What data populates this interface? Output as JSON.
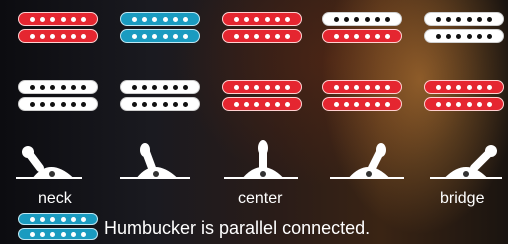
{
  "positions": [
    {
      "label": "neck",
      "row1": [
        "red",
        "red"
      ],
      "row2": [
        "white",
        "white"
      ]
    },
    {
      "label": "",
      "row1": [
        "blue",
        "blue"
      ],
      "row2": [
        "white",
        "white"
      ]
    },
    {
      "label": "center",
      "row1": [
        "red",
        "red"
      ],
      "row2": [
        "red",
        "red"
      ]
    },
    {
      "label": "",
      "row1": [
        "white",
        "red"
      ],
      "row2": [
        "red",
        "red"
      ]
    },
    {
      "label": "bridge",
      "row1": [
        "white",
        "white"
      ],
      "row2": [
        "red",
        "red"
      ]
    }
  ],
  "legend": {
    "icon_color": "blue",
    "text": "Humbucker is parallel connected."
  },
  "colors": {
    "red": "#e52630",
    "white": "#ffffff",
    "blue": "#1a9bc0"
  }
}
